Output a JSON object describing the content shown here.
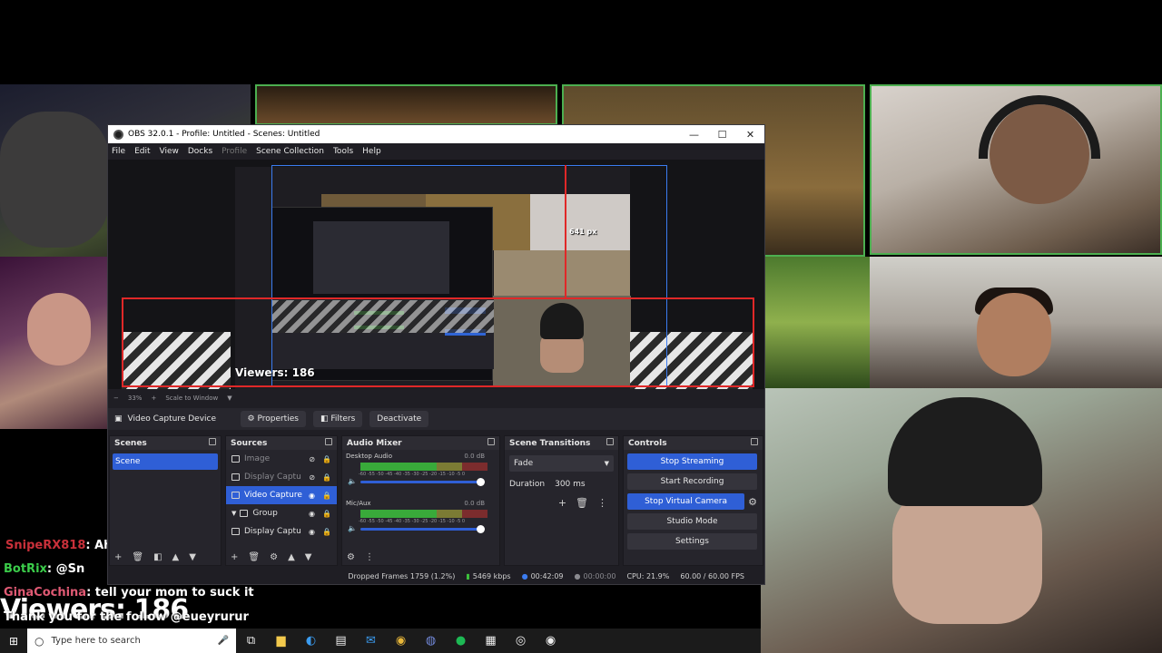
{
  "obs": {
    "title": "OBS 32.0.1 - Profile: Untitled - Scenes: Untitled",
    "window_controls": [
      "—",
      "☐",
      "✕"
    ],
    "menu": [
      "File",
      "Edit",
      "View",
      "Docks",
      "Profile",
      "Scene Collection",
      "Tools",
      "Help"
    ],
    "preview": {
      "px_label": "641 px",
      "viewers_overlay": "Viewers: 186"
    },
    "zoom": {
      "percent": "33%",
      "scale": "Scale to Window"
    },
    "source_toolbar": {
      "device": "Video Capture Device",
      "properties": "Properties",
      "filters": "Filters",
      "deactivate": "Deactivate"
    },
    "scenes": {
      "header": "Scenes",
      "items": [
        "Scene"
      ]
    },
    "sources": {
      "header": "Sources",
      "items": [
        {
          "label": "Image"
        },
        {
          "label": "Display Captu"
        },
        {
          "label": "Video Capture"
        },
        {
          "label": "Group"
        },
        {
          "label": "Display Captu"
        }
      ]
    },
    "mixer": {
      "header": "Audio Mixer",
      "channels": [
        {
          "name": "Desktop Audio",
          "db": "0.0 dB"
        },
        {
          "name": "Mic/Aux",
          "db": "0.0 dB"
        }
      ],
      "scale": "-60 -55 -50 -45 -40 -35 -30 -25 -20 -15 -10 -5 0"
    },
    "transitions": {
      "header": "Scene Transitions",
      "type": "Fade",
      "duration_label": "Duration",
      "duration_value": "300 ms"
    },
    "controls": {
      "header": "Controls",
      "stop_streaming": "Stop Streaming",
      "start_recording": "Start Recording",
      "stop_virtual_camera": "Stop Virtual Camera",
      "studio_mode": "Studio Mode",
      "settings": "Settings"
    },
    "status": {
      "dropped": "Dropped Frames 1759 (1.2%)",
      "bitrate": "5469 kbps",
      "stream_time": "00:42:09",
      "rec_time": "00:00:00",
      "cpu": "CPU: 21.9%",
      "fps": "60.00 / 60.00 FPS"
    }
  },
  "chat": {
    "line1_user": "SnipeRX818",
    "line1_text": ": Ah",
    "line2_user": "BotRix",
    "line2_text": ": @Sn",
    "line3_user": "GinaCochina",
    "line3_text": ": tell your mom to suck it",
    "viewers": "Viewers: 186",
    "line4_text": "Thank you for the follow @eueyrurur"
  },
  "taskbar": {
    "search_placeholder": "Type here to search"
  },
  "colors": {
    "accent": "#2f5fd6",
    "selection_red": "#e02828",
    "meter_green": "#3cc13c"
  }
}
